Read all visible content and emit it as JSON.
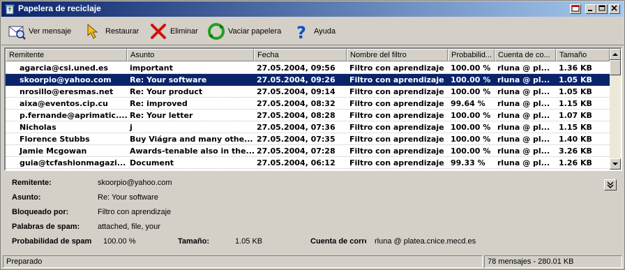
{
  "window": {
    "title": "Papelera de reciclaje"
  },
  "toolbar": {
    "view_label": "Ver mensaje",
    "restore_label": "Restaurar",
    "delete_label": "Eliminar",
    "empty_label": "Vaciar papelera",
    "help_label": "Ayuda"
  },
  "list": {
    "columns": [
      "Remitente",
      "Asunto",
      "Fecha",
      "Nombre del filtro",
      "Probabilid...",
      "Cuenta de co...",
      "Tamaño"
    ],
    "selected_index": 1,
    "rows": [
      [
        "agarcia@csi.uned.es",
        "important",
        "27.05.2004, 09:56",
        "Filtro con aprendizaje",
        "100.00 %",
        "rluna @ pl...",
        "1.36 KB"
      ],
      [
        "skoorpio@yahoo.com",
        "Re: Your software",
        "27.05.2004, 09:26",
        "Filtro con aprendizaje",
        "100.00 %",
        "rluna @ pl...",
        "1.05 KB"
      ],
      [
        "nrosillo@eresmas.net",
        "Re: Your product",
        "27.05.2004, 09:14",
        "Filtro con aprendizaje",
        "100.00 %",
        "rluna @ pl...",
        "1.05 KB"
      ],
      [
        "aixa@eventos.cip.cu",
        "Re: improved",
        "27.05.2004, 08:32",
        "Filtro con aprendizaje",
        "99.64 %",
        "rluna @ pl...",
        "1.15 KB"
      ],
      [
        "p.fernande@aprimatic....",
        "Re: Your letter",
        "27.05.2004, 08:28",
        "Filtro con aprendizaje",
        "100.00 %",
        "rluna @ pl...",
        "1.07 KB"
      ],
      [
        "Nicholas",
        "j",
        "27.05.2004, 07:36",
        "Filtro con aprendizaje",
        "100.00 %",
        "rluna @ pl...",
        "1.15 KB"
      ],
      [
        "Florence Stubbs",
        "Buy Viágra and many othe...",
        "27.05.2004, 07:35",
        "Filtro con aprendizaje",
        "100.00 %",
        "rluna @ pl...",
        "1.40 KB"
      ],
      [
        "Jamie Mcgowan",
        "Awards-tenable also in the...",
        "27.05.2004, 07:28",
        "Filtro con aprendizaje",
        "100.00 %",
        "rluna @ pl...",
        "3.26 KB"
      ],
      [
        "guia@tcfashionmagazi...",
        "Document",
        "27.05.2004, 06:12",
        "Filtro con aprendizaje",
        "99.33 %",
        "rluna @ pl...",
        "1.26 KB"
      ]
    ]
  },
  "details": {
    "sender_label": "Remitente:",
    "sender_value": "skoorpio@yahoo.com",
    "subject_label": "Asunto:",
    "subject_value": "Re: Your software",
    "blocked_label": "Bloqueado por:",
    "blocked_value": "Filtro con aprendizaje",
    "spamwords_label": "Palabras de spam:",
    "spamwords_value": "attached, file, your",
    "prob_label": "Probabilidad de spam",
    "prob_value": "100.00 %",
    "size_label": "Tamaño:",
    "size_value": "1.05 KB",
    "account_label": "Cuenta de correo:",
    "account_value": "rluna @ platea.cnice.mecd.es"
  },
  "status": {
    "left": "Preparado",
    "right": "78 mensajes - 280.01 KB"
  }
}
